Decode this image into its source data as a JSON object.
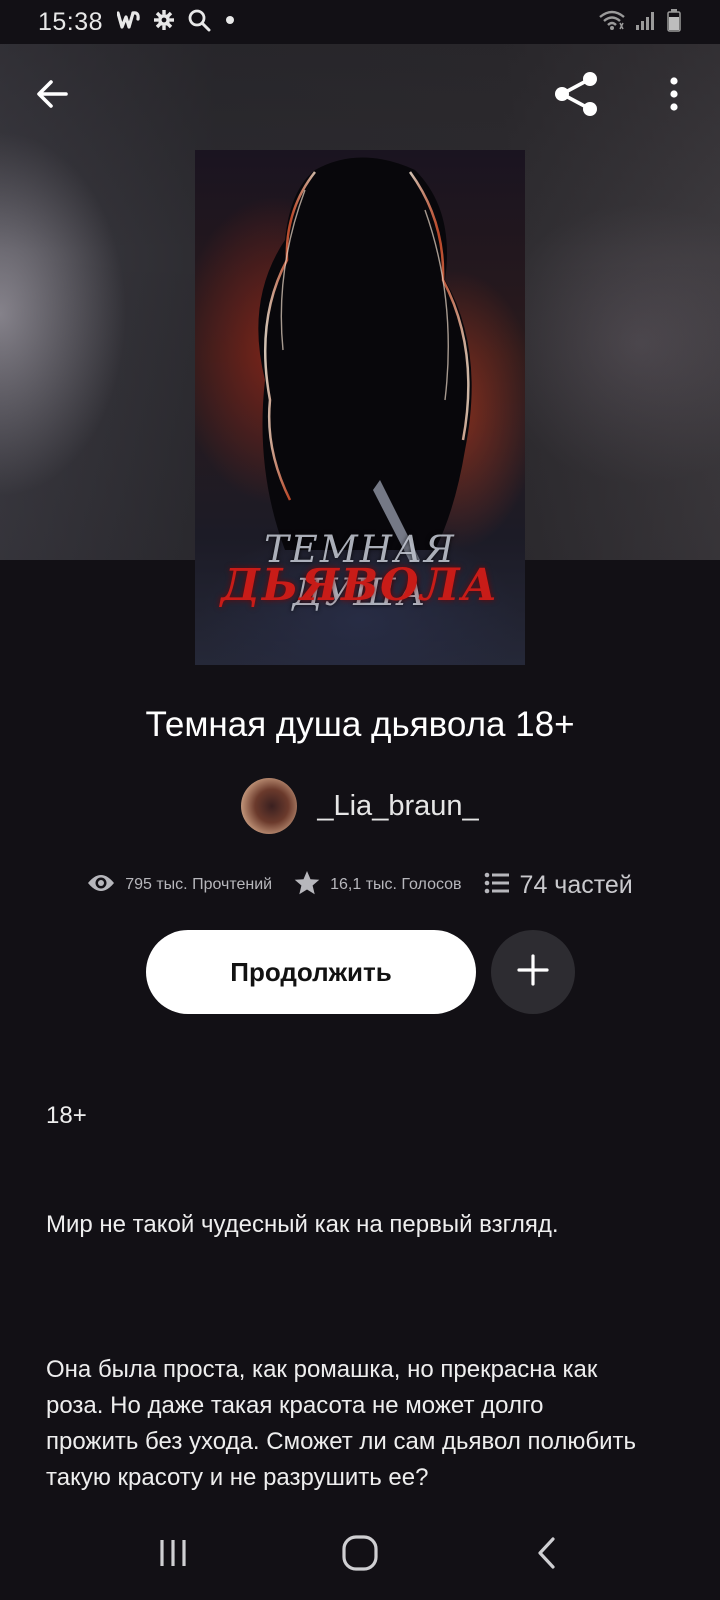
{
  "status_bar": {
    "time": "15:38",
    "left_icons": [
      "wattpad-icon",
      "gear-icon",
      "search-icon",
      "dot-icon"
    ],
    "right_icons": [
      "wifi-icon",
      "signal-icon",
      "battery-icon"
    ]
  },
  "header": {
    "back_icon": "arrow-left-icon",
    "share_icon": "share-icon",
    "more_icon": "more-vertical-icon"
  },
  "cover": {
    "line1": "ТЕМНАЯ ДУША",
    "line2": "ДЬЯВОЛА"
  },
  "book": {
    "title": "Темная душа дьявола 18+",
    "author": "_Lia_braun_"
  },
  "stats": {
    "reads": "795 тыс. Прочтений",
    "votes": "16,1 тыс. Голосов",
    "parts": "74 частей"
  },
  "actions": {
    "continue_label": "Продолжить",
    "add_icon": "plus-icon"
  },
  "description": {
    "age": "18+",
    "p1": "Мир не такой чудесный как  на первый взгляд.",
    "p2": "Она была проста, как ромашка, но прекрасна как роза. Но даже такая красота не может долго прожить без ухода. Сможет ли сам дьявол полюбить такую красоту и не разрушить ее?"
  },
  "nav_bar": {
    "recent_icon": "recent-apps-icon",
    "home_icon": "home-icon",
    "back_icon": "nav-back-icon"
  }
}
